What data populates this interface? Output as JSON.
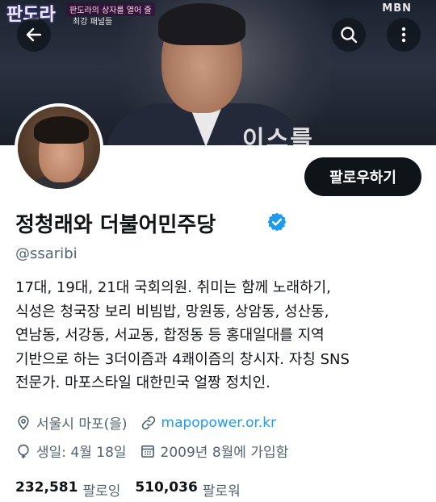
{
  "banner": {
    "show_logo": "판도라",
    "show_sub1": "판도라의 상자를 열어 줄",
    "show_sub2": "최강 패널들",
    "channel": "MBN",
    "caption_partial": "이스를"
  },
  "nav": {
    "back_icon": "arrow-left-icon",
    "search_icon": "search-icon",
    "more_icon": "more-vertical-icon"
  },
  "profile": {
    "follow_label": "팔로우하기",
    "display_name": "정청래와 더불어민주당",
    "handle": "@ssaribi",
    "bio": "17대, 19대, 21대 국회의원. 취미는 함께 노래하기,\n식성은 청국장 보리 비빔밥, 망원동, 상암동, 성산동,\n연남동, 서강동, 서교동, 합정동 등 홍대일대를 지역\n기반으로 하는 3더이즘과 4쾌이즘의 창시자. 자칭 SNS\n전문가. 마포스타일 대한민국 얼짱 정치인.",
    "location": "서울시 마포(을)",
    "website": "mapopower.or.kr",
    "birthday": "생일: 4월 18일",
    "joined": "2009년 8월에 가입함"
  },
  "stats": {
    "following_count": "232,581",
    "following_label": "팔로잉",
    "followers_count": "510,036",
    "followers_label": "팔로워"
  },
  "colors": {
    "accent": "#1d9bf0",
    "text": "#0f1419",
    "muted": "#536471"
  }
}
